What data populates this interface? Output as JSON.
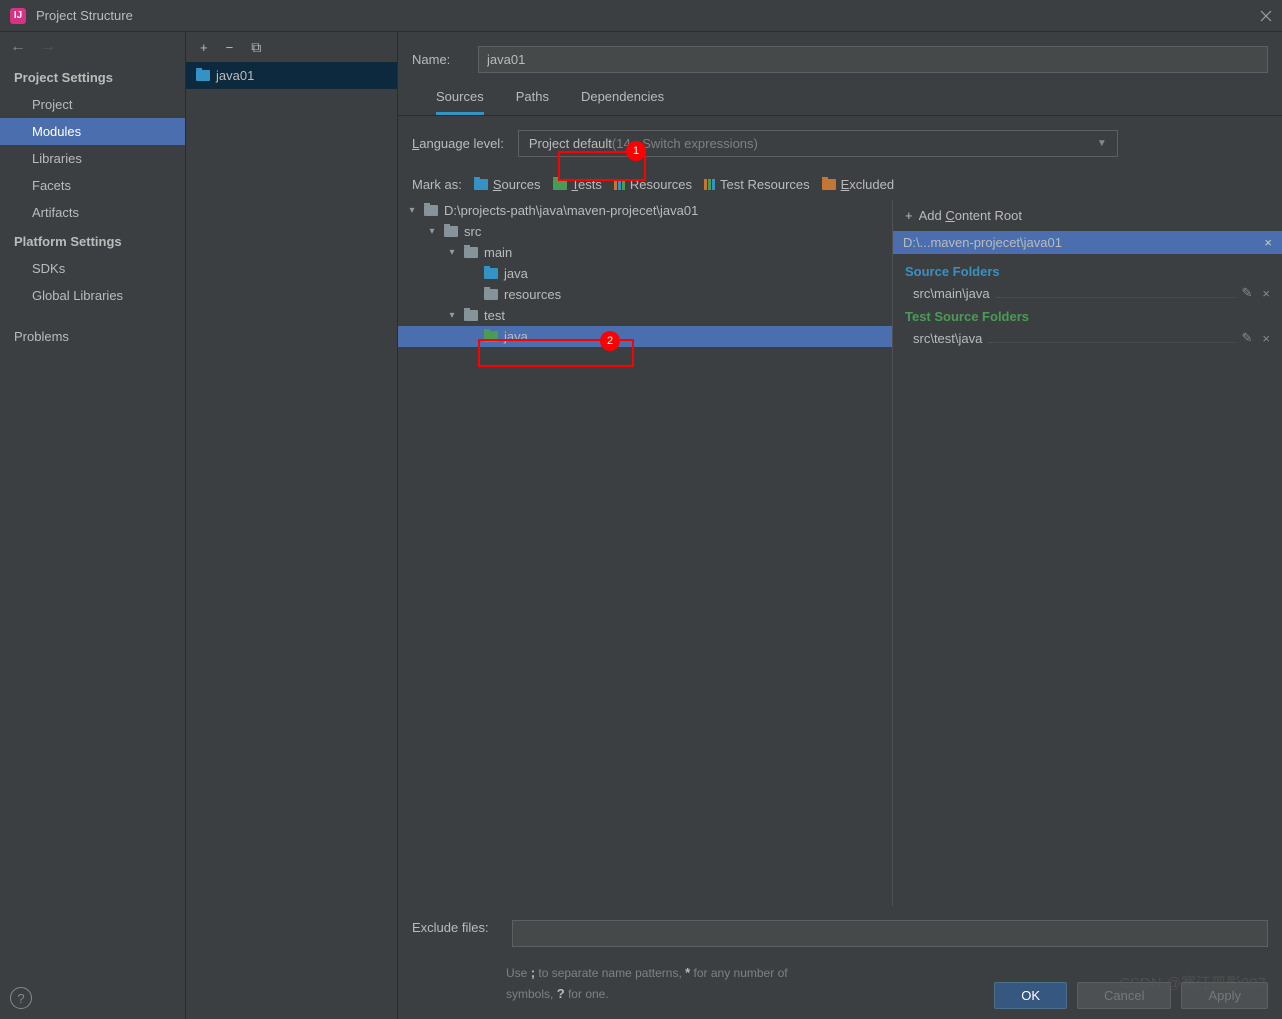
{
  "title": "Project Structure",
  "sidebar": {
    "sections": [
      {
        "header": "Project Settings",
        "items": [
          "Project",
          "Modules",
          "Libraries",
          "Facets",
          "Artifacts"
        ],
        "selected": 1
      },
      {
        "header": "Platform Settings",
        "items": [
          "SDKs",
          "Global Libraries"
        ]
      },
      {
        "header": "",
        "items": [
          "Problems"
        ]
      }
    ]
  },
  "modules": {
    "items": [
      "java01"
    ],
    "selected": 0
  },
  "form": {
    "name_label": "Name:",
    "name_value": "java01"
  },
  "tabs": {
    "items": [
      "Sources",
      "Paths",
      "Dependencies"
    ],
    "active": 0
  },
  "language": {
    "label": "Language level:",
    "value": "Project default ",
    "hint": "(14 - Switch expressions)"
  },
  "mark": {
    "label": "Mark as:",
    "buttons": [
      {
        "label": "Sources",
        "color": "#3592c4",
        "u": "S"
      },
      {
        "label": "Tests",
        "color": "#499c54",
        "u": "T"
      },
      {
        "label": "Resources",
        "color": "#3592c4",
        "icon": "res"
      },
      {
        "label": "Test Resources",
        "color": "#499c54",
        "icon": "res"
      },
      {
        "label": "Excluded",
        "color": "#c57633",
        "u": "E"
      }
    ]
  },
  "tree": [
    {
      "depth": 0,
      "chev": "▾",
      "icon": "grey",
      "label": "D:\\projects-path\\java\\maven-projecet\\java01"
    },
    {
      "depth": 1,
      "chev": "▾",
      "icon": "grey",
      "label": "src"
    },
    {
      "depth": 2,
      "chev": "▾",
      "icon": "grey",
      "label": "main"
    },
    {
      "depth": 3,
      "chev": "",
      "icon": "blue",
      "label": "java"
    },
    {
      "depth": 3,
      "chev": "",
      "icon": "grey",
      "label": "resources"
    },
    {
      "depth": 2,
      "chev": "▾",
      "icon": "grey",
      "label": "test"
    },
    {
      "depth": 3,
      "chev": "",
      "icon": "green",
      "label": "java",
      "selected": true
    }
  ],
  "right": {
    "add": "Add Content Root",
    "root": "D:\\...maven-projecet\\java01",
    "groups": [
      {
        "header": "Source Folders",
        "cls": "blue",
        "items": [
          "src\\main\\java"
        ]
      },
      {
        "header": "Test Source Folders",
        "cls": "green",
        "items": [
          "src\\test\\java"
        ]
      }
    ]
  },
  "exclude": {
    "label": "Exclude files:",
    "hint": "Use ; to separate name patterns, * for any number of symbols, ? for one."
  },
  "footer": {
    "ok": "OK",
    "cancel": "Cancel",
    "apply": "Apply"
  },
  "watermark": "CSDN @寒江孤影007",
  "annotations": {
    "b1": "1",
    "b2": "2"
  }
}
